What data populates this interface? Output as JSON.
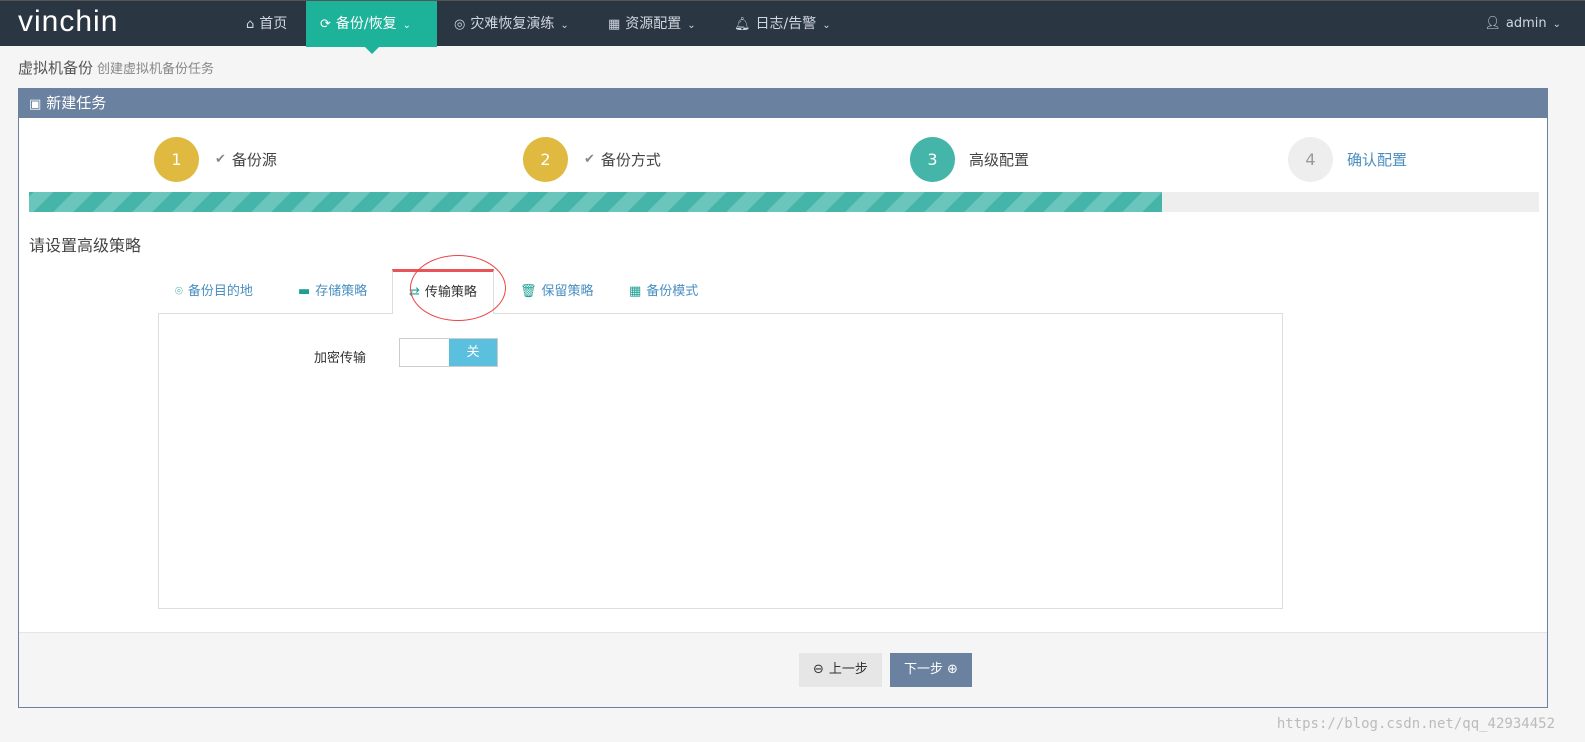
{
  "nav": {
    "logo": "vinchin",
    "items": [
      {
        "label": "首页",
        "icon": "home-icon"
      },
      {
        "label": "备份/恢复",
        "icon": "refresh-icon",
        "active": true
      },
      {
        "label": "灾难恢复演练",
        "icon": "webcam-icon"
      },
      {
        "label": "资源配置",
        "icon": "grid-icon"
      },
      {
        "label": "日志/告警",
        "icon": "bell-icon"
      }
    ],
    "user": "admin"
  },
  "breadcrumb": {
    "title": "虚拟机备份",
    "subtitle": "创建虚拟机备份任务"
  },
  "panel": {
    "title": "新建任务",
    "steps": [
      {
        "num": "1",
        "label": "备份源",
        "done": true,
        "color": "#e0b940"
      },
      {
        "num": "2",
        "label": "备份方式",
        "done": true,
        "color": "#e0b940"
      },
      {
        "num": "3",
        "label": "高级配置",
        "color": "#45b5aa"
      },
      {
        "num": "4",
        "label": "确认配置",
        "color": "#eeeeee"
      }
    ],
    "progress_percent": 75,
    "section_title": "请设置高级策略",
    "tabs": [
      {
        "label": "备份目的地",
        "icon": "map-marker-icon"
      },
      {
        "label": "存储策略",
        "icon": "hdd-icon"
      },
      {
        "label": "传输策略",
        "icon": "exchange-icon",
        "active": true
      },
      {
        "label": "保留策略",
        "icon": "trash-icon"
      },
      {
        "label": "备份模式",
        "icon": "grid-icon"
      }
    ],
    "encrypt_label": "加密传输",
    "encrypt_value": "关",
    "prev": "上一步",
    "next": "下一步"
  },
  "watermark": "https://blog.csdn.net/qq_42934452"
}
